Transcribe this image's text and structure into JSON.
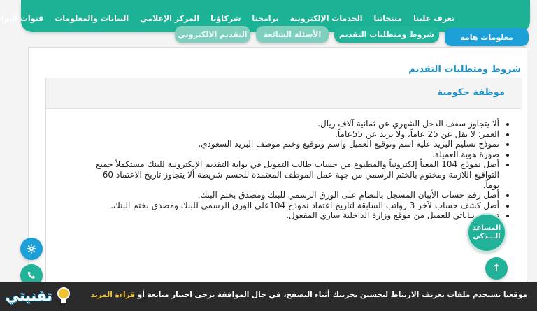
{
  "nav": {
    "items": [
      "تعرف علينا",
      "منتجاتنا",
      "الخدمات الإلكترونية",
      "برامجنا",
      "شركاؤنا",
      "المركز الإعلامي",
      "البيانات والمعلومات",
      "قنوات التواصل"
    ]
  },
  "tabs": {
    "important_info": "معلومات هامة",
    "conditions": "شروط ومتطلبات التقديم",
    "faq": "الأسئلة الشائعة",
    "e_apply": "التقديم الالكتروني"
  },
  "section_title": "شروط ومتطلبات التقديم",
  "card_title": "موظفة حكومية",
  "requirements": [
    "ألا يتجاوز سقف الدخل الشهري عن ثمانية آلاف ريال.",
    "العمر: لا يقل عن  25  عاماً، ولا يزيد عن 55عاماً.",
    "نموذج تسليم البريد عليه اسم وتوقيع العميل واسم وتوقيع وختم موظف البريد السعودي.",
    "صورة هوية العميلة.",
    "أصل نموذج 104 المعبأ إلكترونياً والمطبوع من حساب طالب التمويل في بوابة التقديم الإلكترونية للبنك مستكملاً جميع التواقيع اللازمة ومختوم بالختم الرسمي من جهة عمل الموظف المعتمدة للحسم شريطة ألا يتجاوز تاريخ الاعتماد 60 يوماً.",
    "أصل رقم حساب الأيبان المسجل بالنظام على الورق الرسمي للبنك ومصدق بختم البنك.",
    "أصل كشف حساب لآخر  3  رواتب السابقة لتاريخ اعتماد نموذج  104على الورق الرسمي للبنك ومصدق بختم البنك.",
    "تصريح بياناتي للعميل من موقع وزارة الداخلية ساري المفعول."
  ],
  "assistant": {
    "line1": "المساعد",
    "line2": "الـــذكي"
  },
  "scroll_top_icon": "arrow-up-icon",
  "cookie": {
    "text": "موقعنا يستخدم ملفات تعريف الارتباط لتحسين تجربتك أثناء التصفح، في حال الموافقة يرجى اختيار متابعة أو ",
    "link": "قراءة المزيد"
  },
  "logo": {
    "text": "تقنيتي"
  },
  "colors": {
    "nav_green": "#1bb295",
    "tab_blue": "#1d9fd8",
    "title_blue": "#1a8fc9",
    "cookie_bg": "#2b2b2b",
    "link_yellow": "#f2c230"
  }
}
